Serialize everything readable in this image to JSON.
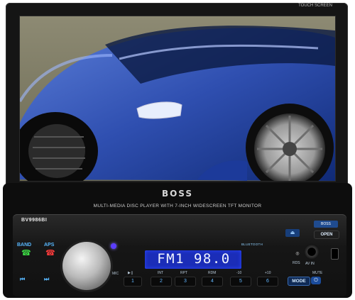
{
  "monitor": {
    "touch_label": "TOUCH SCREEN",
    "brand": "BOSS",
    "subtitle": "MULTI-MEDIA DISC PLAYER WITH 7-INCH WIDESCREEN TFT MONITOR"
  },
  "faceplate": {
    "model": "BV9986BI",
    "display_text": "FM1 98.0",
    "bluetooth_label": "BLUETOOTH",
    "open_label": "OPEN",
    "mode_label": "MODE",
    "band_label": "BAND",
    "aps_label": "APS",
    "mic_label": "MIC",
    "mute_label": "MUTE",
    "avin_label": "AV IN",
    "rds_label": "RDS",
    "preset_keys": [
      {
        "label": "INT",
        "number": "2"
      },
      {
        "label": "RPT",
        "number": "3"
      },
      {
        "label": "RDM",
        "number": "4"
      },
      {
        "label": "-10",
        "number": "5"
      },
      {
        "label": "+10",
        "number": "6"
      }
    ],
    "key1_number": "1"
  }
}
